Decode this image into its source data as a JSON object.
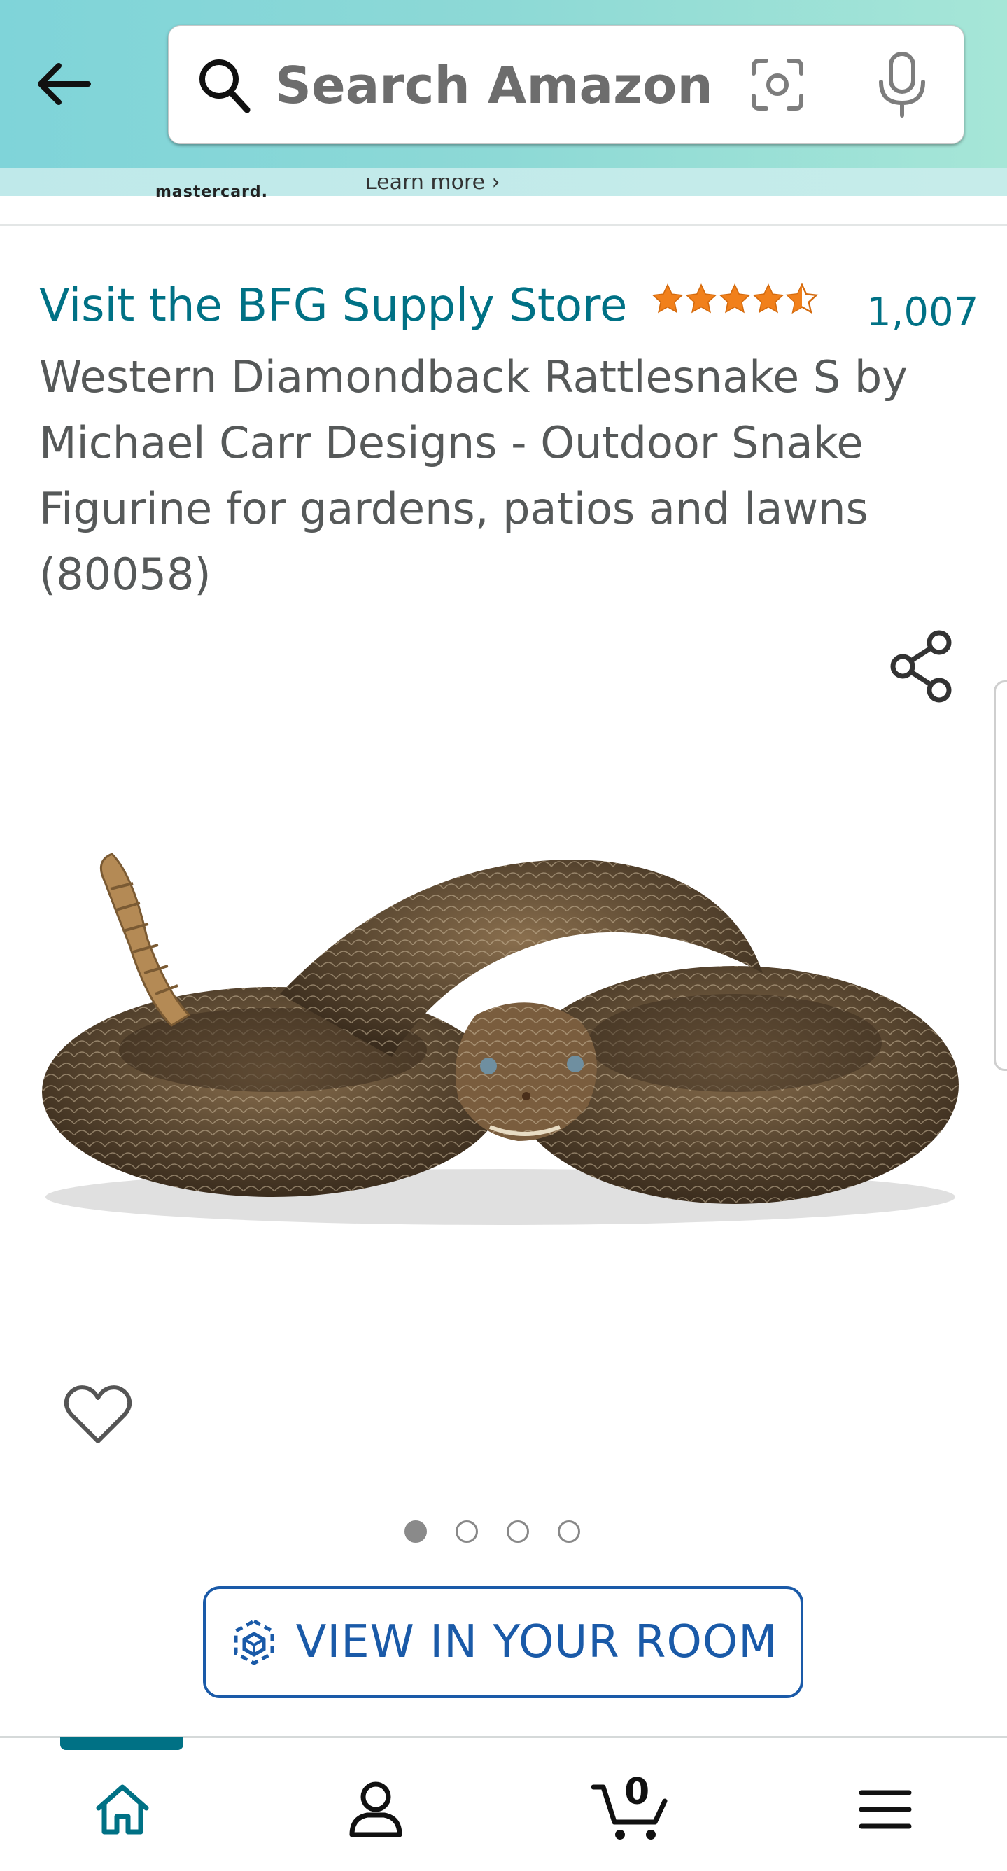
{
  "header": {
    "search": {
      "placeholder": "Search Amazon"
    },
    "promo": {
      "logo_text": "mastercard.",
      "link_text": "Learn more ›"
    }
  },
  "product": {
    "store_link": "Visit the BFG Supply Store",
    "rating": 4.5,
    "rating_count": "1,007",
    "title": "Western Diamondback Rattlesnake S by Michael Carr Designs - Outdoor Snake Figurine for gardens, patios and lawns (80058)",
    "image_count": 4,
    "active_image": 0,
    "view_in_room": "VIEW IN YOUR ROOM"
  },
  "nav": {
    "cart_count": "0",
    "active": "home"
  },
  "colors": {
    "link": "#007185",
    "star": "#f1801b",
    "button_blue": "#1a5aa8",
    "header_start": "#7fd4d9",
    "header_end": "#a6e6d7"
  }
}
